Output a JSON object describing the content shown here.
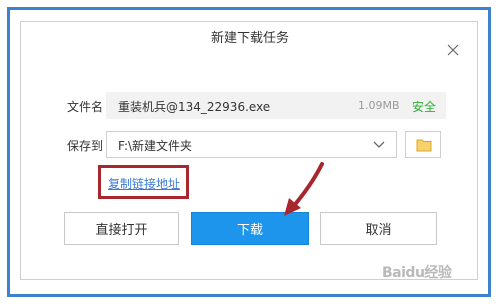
{
  "dialog": {
    "title": "新建下载任务",
    "file_label": "文件名",
    "file_name": "重装机兵@134_22936.exe",
    "file_size": "1.09MB",
    "file_status": "安全",
    "save_label": "保存到",
    "save_path": "F:\\新建文件夹",
    "copy_link": "复制链接地址",
    "buttons": {
      "open": "直接打开",
      "download": "下载",
      "cancel": "取消"
    }
  },
  "watermark": "Baidu经验",
  "colors": {
    "frame": "#3d82cc",
    "primary": "#1e95ec",
    "safe": "#2eaf38",
    "link": "#3a7bd5",
    "annotation": "#a8262d"
  },
  "icons": [
    "close-icon",
    "chevron-down-icon",
    "folder-icon",
    "annotation-arrow"
  ]
}
